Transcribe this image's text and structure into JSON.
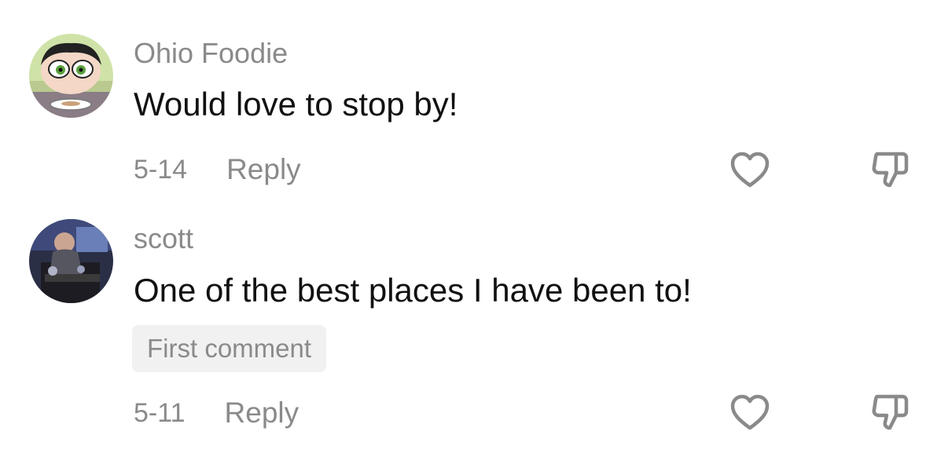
{
  "comments": [
    {
      "username": "Ohio Foodie",
      "text": "Would love to stop by!",
      "date": "5-14",
      "reply_label": "Reply",
      "badge": null
    },
    {
      "username": "scott",
      "text": "One of the best places I have been to!",
      "date": "5-11",
      "reply_label": "Reply",
      "badge": "First comment"
    }
  ],
  "icons": {
    "like": "heart-icon",
    "dislike": "thumbs-down-icon"
  },
  "colors": {
    "meta_gray": "#8a8a8a",
    "text": "#111111",
    "badge_bg": "#f1f1f2"
  }
}
